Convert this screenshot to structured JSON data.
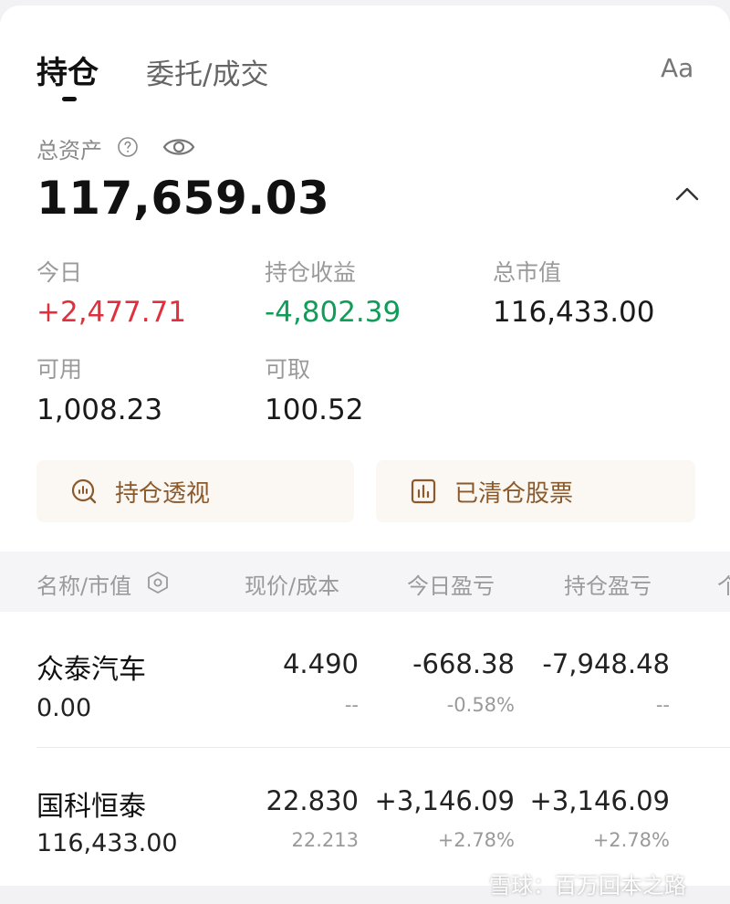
{
  "tabs": {
    "active": "持仓",
    "inactive": "委托/成交",
    "font_toggle": "Aa"
  },
  "summary": {
    "total_assets_label": "总资产",
    "total_assets_value": "117,659.03",
    "stats": {
      "today_label": "今日",
      "today_value": "+2,477.71",
      "holding_pnl_label": "持仓收益",
      "holding_pnl_value": "-4,802.39",
      "market_value_label": "总市值",
      "market_value_value": "116,433.00",
      "available_label": "可用",
      "available_value": "1,008.23",
      "withdrawable_label": "可取",
      "withdrawable_value": "100.52"
    }
  },
  "actions": {
    "perspective": "持仓透视",
    "cleared": "已清仓股票"
  },
  "table": {
    "headers": [
      "名称/市值",
      "现价/成本",
      "今日盈亏",
      "持仓盈亏",
      "个"
    ],
    "rows": [
      {
        "name": "众泰汽车",
        "market_value": "0.00",
        "price": "4.490",
        "cost": "--",
        "today_pnl": "-668.38",
        "today_pct": "-0.58%",
        "holding_pnl": "-7,948.48",
        "holding_pct": "--"
      },
      {
        "name": "国科恒泰",
        "market_value": "116,433.00",
        "price": "22.830",
        "cost": "22.213",
        "today_pnl": "+3,146.09",
        "today_pct": "+2.78%",
        "holding_pnl": "+3,146.09",
        "holding_pct": "+2.78%"
      }
    ]
  },
  "watermark": "雪球：百万回本之路",
  "colors": {
    "gain": "#e0303e",
    "loss": "#0f9d58",
    "accent": "#8a5a2c",
    "button_bg": "#fbf7f2"
  },
  "icons": {
    "help": "question-circle-icon",
    "visibility": "eye-icon",
    "collapse": "chevron-up-icon",
    "perspective": "magnifier-chart-icon",
    "cleared": "bar-chart-box-icon",
    "sort": "hexagon-settings-icon"
  }
}
